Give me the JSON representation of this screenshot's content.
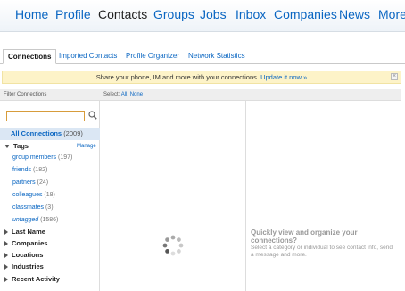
{
  "nav": {
    "items": [
      {
        "label": "Home"
      },
      {
        "label": "Profile"
      },
      {
        "label": "Contacts"
      },
      {
        "label": "Groups"
      },
      {
        "label": "Jobs"
      },
      {
        "label": "Inbox"
      },
      {
        "label": "Companies"
      },
      {
        "label": "News"
      },
      {
        "label": "More"
      }
    ],
    "active": "Contacts"
  },
  "tabs": [
    {
      "label": "Connections"
    },
    {
      "label": "Imported Contacts"
    },
    {
      "label": "Profile Organizer"
    },
    {
      "label": "Network Statistics"
    }
  ],
  "notice": {
    "text": "Share your phone, IM and more with your connections.",
    "link": "Update it now »"
  },
  "filter": {
    "header": "Filter Connections",
    "search_placeholder": ""
  },
  "select": {
    "label": "Select:",
    "all": "All",
    "sep": ",",
    "none": "None"
  },
  "sidebar": {
    "all_connections": {
      "label": "All Connections",
      "count": "(2009)"
    },
    "tags": {
      "label": "Tags",
      "manage": "Manage",
      "items": [
        {
          "name": "group members",
          "count": "(197)"
        },
        {
          "name": "friends",
          "count": "(182)"
        },
        {
          "name": "partners",
          "count": "(24)"
        },
        {
          "name": "colleagues",
          "count": "(18)"
        },
        {
          "name": "classmates",
          "count": "(3)"
        },
        {
          "name": "untagged",
          "count": "(1586)"
        }
      ]
    },
    "sections": [
      {
        "label": "Last Name"
      },
      {
        "label": "Companies"
      },
      {
        "label": "Locations"
      },
      {
        "label": "Industries"
      },
      {
        "label": "Recent Activity"
      }
    ]
  },
  "detail": {
    "heading": "Quickly view and organize your connections?",
    "body": "Select a category or individual to see contact info, send a message and more."
  },
  "colors": {
    "link": "#0a66c2",
    "notice_bg": "#fdf3c8",
    "selected_bg": "#dbe7f4"
  }
}
